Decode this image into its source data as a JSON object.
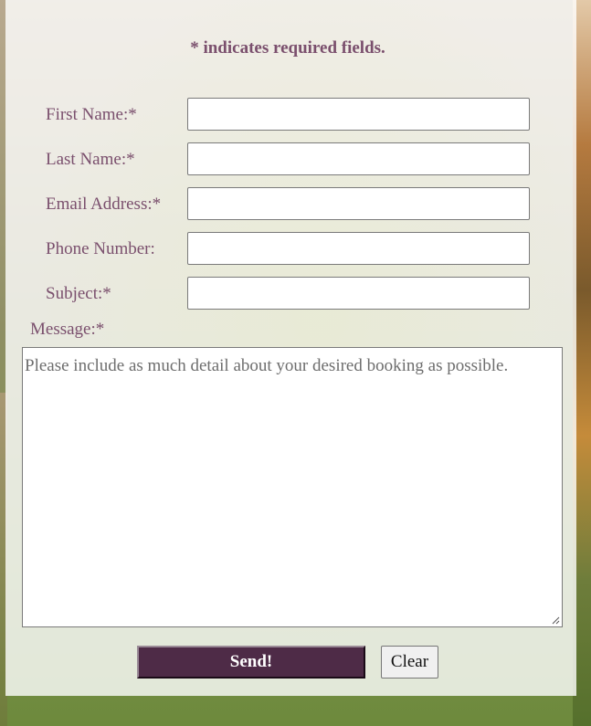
{
  "form": {
    "required_note": "* indicates required fields.",
    "fields": [
      {
        "label": "First Name:*",
        "value": ""
      },
      {
        "label": "Last Name:*",
        "value": ""
      },
      {
        "label": "Email Address:*",
        "value": ""
      },
      {
        "label": "Phone Number:",
        "value": ""
      },
      {
        "label": "Subject:*",
        "value": ""
      }
    ],
    "message": {
      "label": "Message:*",
      "placeholder": "Please include as much detail about your desired booking as possible."
    },
    "send_label": "Send!",
    "clear_label": "Clear"
  },
  "colors": {
    "label_text": "#7a4f6d",
    "send_button": "#4e2b47"
  }
}
